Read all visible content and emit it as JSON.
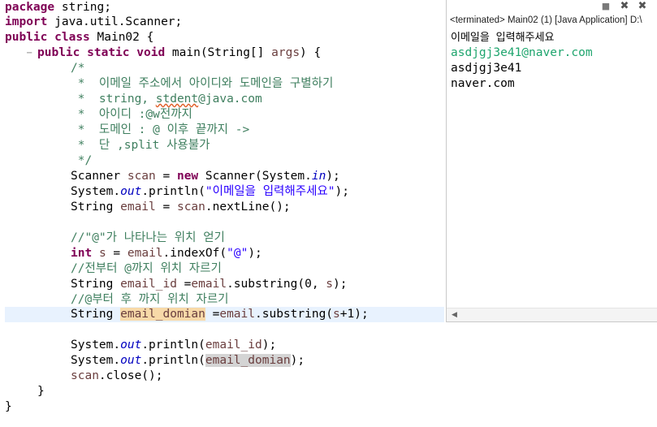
{
  "code": {
    "l1": {
      "kw": "package",
      "rest": " string;"
    },
    "l2": {
      "kw": "import",
      "rest": " java.util.Scanner;"
    },
    "l3": {
      "kw1": "public",
      "kw2": "class",
      "rest": " Main02 {"
    },
    "l4": {
      "kw1": "public",
      "kw2": "static",
      "kw3": "void",
      "name": " main(String[] ",
      "arg": "args",
      "rest": ") {"
    },
    "l5": "/*",
    "l6": " *  이메일 주소에서 아이디와 도메인을 구별하기",
    "l7a": " *  string, ",
    "l7b": "stdent",
    "l7c": "@java.com",
    "l8": " *  아이디 :@w전까지",
    "l9": " *  도메인 : @ 이후 끝까지 ->",
    "l10": " *  단 ,split 사용불가",
    "l11": " */",
    "l12": {
      "t1": "Scanner ",
      "v": "scan",
      "t2": " = ",
      "kw": "new",
      "t3": " Scanner(System.",
      "fld": "in",
      "t4": ");"
    },
    "l13": {
      "t1": "System.",
      "fld": "out",
      "t2": ".println(",
      "str": "\"이메일을 입력해주세요\"",
      "t3": ");"
    },
    "l14": {
      "t1": "String ",
      "v": "email",
      "t2": " = ",
      "v2": "scan",
      "t3": ".nextLine();"
    },
    "l16": "//\"@\"가 나타나는 위치 얻기",
    "l17": {
      "kw": "int",
      "t1": " ",
      "v": "s",
      "t2": " = ",
      "v2": "email",
      "t3": ".indexOf(",
      "str": "\"@\"",
      "t4": ");"
    },
    "l18": "//전부터 @까지 위치 자르기",
    "l19": {
      "t1": "String ",
      "v": "email_id",
      "t2": " =",
      "v2": "email",
      "t3": ".substring(0, ",
      "v3": "s",
      "t4": ");"
    },
    "l20": "//@부터 후 까지 위치 자르기",
    "l21": {
      "t1": "String ",
      "v": "email_domian",
      "t2": " =",
      "v2": "email",
      "t3": ".substring(",
      "v3": "s",
      "t4": "+1);"
    },
    "l23": {
      "t1": "System.",
      "fld": "out",
      "t2": ".println(",
      "v": "email_id",
      "t3": ");"
    },
    "l24": {
      "t1": "System.",
      "fld": "out",
      "t2": ".println(",
      "v": "email_domian",
      "t3": ");"
    },
    "l25": {
      "v": "scan",
      "t1": ".close();"
    },
    "l26": "}",
    "l27": "}"
  },
  "console": {
    "header": "<terminated> Main02 (1) [Java Application] D:\\",
    "lines": [
      "이메일을 입력해주세요",
      "asdjgj3e41@naver.com",
      "asdjgj3e41",
      "naver.com"
    ],
    "input_color": "#1fa56e",
    "buttons": {
      "stop": "■",
      "remove": "✖",
      "remove_all": "✖"
    }
  }
}
